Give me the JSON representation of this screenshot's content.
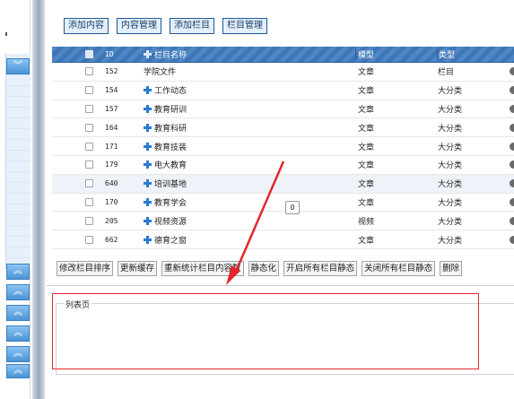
{
  "left_nav": {
    "expand_buttons": [
      "collapse",
      "expand",
      "expand",
      "expand",
      "expand",
      "expand"
    ]
  },
  "tabs": [
    {
      "label": "添加内容"
    },
    {
      "label": "内容管理"
    },
    {
      "label": "添加栏目"
    },
    {
      "label": "栏目管理"
    }
  ],
  "grid": {
    "columns": {
      "id": "ID",
      "name": "栏目名称",
      "model": "模型",
      "type": "类型"
    },
    "rows": [
      {
        "id": "152",
        "name": "学院文件",
        "model": "文章",
        "type": "栏目",
        "has_children": false
      },
      {
        "id": "154",
        "name": "工作动态",
        "model": "文章",
        "type": "大分类",
        "has_children": true
      },
      {
        "id": "157",
        "name": "教育研训",
        "model": "文章",
        "type": "大分类",
        "has_children": true
      },
      {
        "id": "164",
        "name": "教育科研",
        "model": "文章",
        "type": "大分类",
        "has_children": true
      },
      {
        "id": "171",
        "name": "教育技装",
        "model": "文章",
        "type": "大分类",
        "has_children": true
      },
      {
        "id": "179",
        "name": "电大教育",
        "model": "文章",
        "type": "大分类",
        "has_children": true
      },
      {
        "id": "640",
        "name": "培训基地",
        "model": "文章",
        "type": "大分类",
        "has_children": true
      },
      {
        "id": "170",
        "name": "教育学会",
        "model": "文章",
        "type": "大分类",
        "has_children": true
      },
      {
        "id": "205",
        "name": "视频资源",
        "model": "视频",
        "type": "大分类",
        "has_children": true
      },
      {
        "id": "662",
        "name": "德育之窗",
        "model": "文章",
        "type": "大分类",
        "has_children": true
      }
    ]
  },
  "actions": [
    {
      "label": "修改栏目排序"
    },
    {
      "label": "更新缓存"
    },
    {
      "label": "重新统计栏目内容数"
    },
    {
      "label": "静态化"
    },
    {
      "label": "开启所有栏目静态"
    },
    {
      "label": "关闭所有栏目静态"
    },
    {
      "label": "删除"
    }
  ],
  "fieldset": {
    "legend": "列表页"
  },
  "float_badge": "0",
  "colors": {
    "header": "#3e76b6",
    "tab_border": "#1f5a99",
    "annotation": "#e2262c"
  }
}
